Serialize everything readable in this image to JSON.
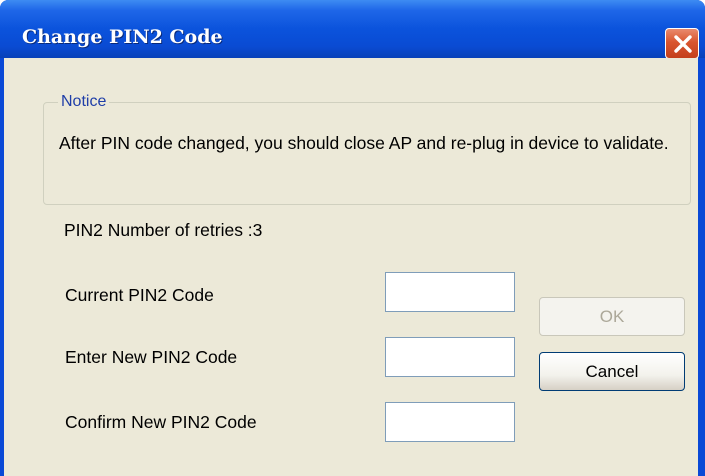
{
  "window": {
    "title": "Change PIN2 Code"
  },
  "notice": {
    "legend": "Notice",
    "text": "After PIN code changed, you should close AP and re-plug in device to validate."
  },
  "retries_label": "PIN2 Number of retries :3",
  "fields": {
    "current": {
      "label": "Current PIN2 Code",
      "value": ""
    },
    "new": {
      "label": "Enter New PIN2 Code",
      "value": ""
    },
    "confirm": {
      "label": "Confirm New PIN2 Code",
      "value": ""
    }
  },
  "buttons": {
    "ok": "OK",
    "cancel": "Cancel"
  },
  "colors": {
    "titlebar": "#0a4bd3",
    "client_bg": "#ece9d8",
    "close": "#d9552f"
  },
  "icons": {
    "close": "close-x-icon"
  }
}
